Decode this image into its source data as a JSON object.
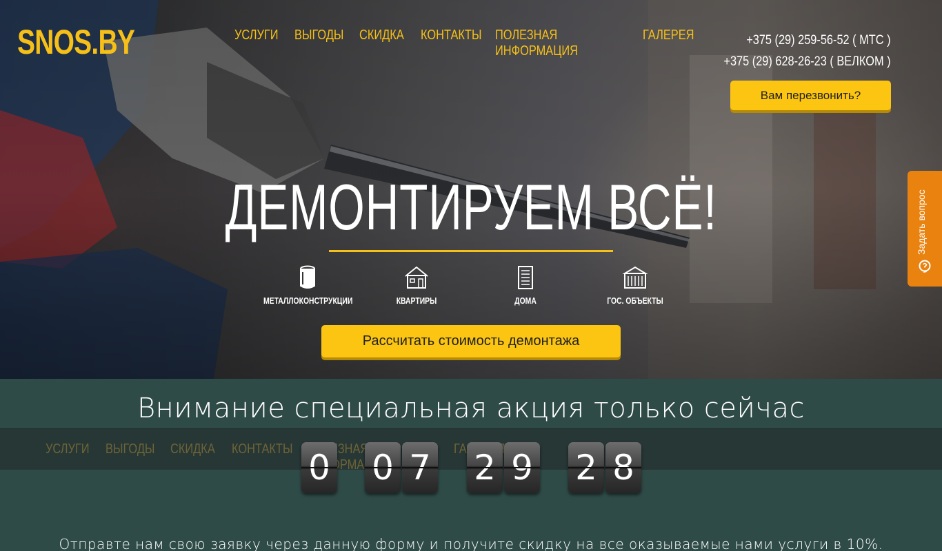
{
  "header": {
    "logo": "SNOS.BY",
    "nav": [
      "УСЛУГИ",
      "ВЫГОДЫ",
      "СКИДКА",
      "КОНТАКТЫ",
      "ПОЛЕЗНАЯ ИНФОРМАЦИЯ",
      "ГАЛЕРЕЯ"
    ],
    "phones": [
      "+375 (29) 259-56-52 ( МТС )",
      "+375 (29) 628-26-23 ( ВЕЛКОМ )"
    ],
    "callback_label": "Вам перезвонить?"
  },
  "hero": {
    "title": "ДЕМОНТИРУЕМ ВСЁ!",
    "categories": [
      {
        "label": "МЕТАЛЛОКОНСТРУКЦИИ",
        "icon": "barrel-icon"
      },
      {
        "label": "КВАРТИРЫ",
        "icon": "house-icon"
      },
      {
        "label": "ДОМА",
        "icon": "building-icon"
      },
      {
        "label": "ГОС. ОБЪЕКТЫ",
        "icon": "government-building-icon"
      }
    ],
    "cta_label": "Рассчитать стоимость демонтажа"
  },
  "side_tab": {
    "label": "Задать вопрос",
    "icon": "question-bubble-icon"
  },
  "promo": {
    "title": "Внимание специальная акция только сейчас",
    "timer_digits": [
      "0",
      "0",
      "7",
      "2",
      "9",
      "2",
      "8"
    ],
    "note": "Отправте нам свою заявку через данную форму и получите скидку на все оказываемые нами услуги в 10%."
  },
  "sticky_nav": [
    "УСЛУГИ",
    "ВЫГОДЫ",
    "СКИДКА",
    "КОНТАКТЫ",
    "ПОЛЕЗНАЯ ИНФОРМАЦИЯ",
    "ГАЛЕРЕЯ"
  ],
  "colors": {
    "accent": "#f6c019",
    "button": "#fcc512",
    "tab": "#e9820f",
    "promo_bg": "#2f4b48"
  }
}
